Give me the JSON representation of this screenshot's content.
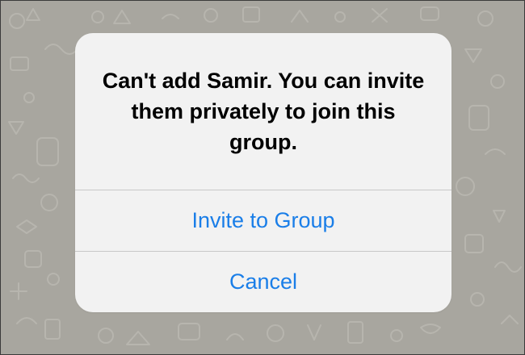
{
  "background": {
    "color": "#a8a69f",
    "pattern": "doodle-wallpaper"
  },
  "alert": {
    "message": "Can't add Samir. You can invite them privately to join this group.",
    "primary_action": "Invite to Group",
    "cancel_action": "Cancel",
    "accent_color": "#1a7ee8"
  }
}
